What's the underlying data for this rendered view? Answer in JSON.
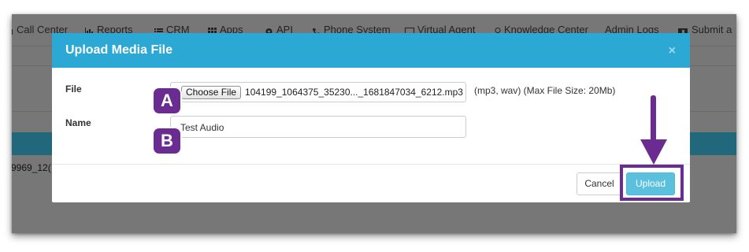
{
  "nav": {
    "items": [
      {
        "label": "Call Center",
        "icon": "phone-icon"
      },
      {
        "label": "Reports",
        "icon": "bar-chart-icon"
      },
      {
        "label": "CRM",
        "icon": "list-icon"
      },
      {
        "label": "Apps",
        "icon": "grid-icon"
      },
      {
        "label": "API",
        "icon": "gear-icon"
      },
      {
        "label": "Phone System",
        "icon": "phone-icon"
      },
      {
        "label": "Virtual Agent",
        "icon": "monitor-icon"
      },
      {
        "label": "Knowledge Center",
        "icon": "lightbulb-icon"
      },
      {
        "label": "Admin Logs",
        "icon": ""
      },
      {
        "label": "Submit a",
        "icon": "ticket-icon"
      }
    ]
  },
  "background": {
    "row_text": "9969_12("
  },
  "modal": {
    "title": "Upload Media File",
    "close_label": "×",
    "file_label": "File",
    "choose_file_label": "Choose File",
    "file_name": "104199_1064375_35230..._1681847034_6212.mp3",
    "file_hint": "(mp3, wav) (Max File Size: 20Mb)",
    "name_label": "Name",
    "name_value": "Test Audio",
    "cancel_label": "Cancel",
    "upload_label": "Upload"
  },
  "annotations": {
    "badge_a": "A",
    "badge_b": "B",
    "accent_color": "#6a2c91"
  },
  "colors": {
    "header": "#2ba8d3",
    "upload_button": "#5bc0de",
    "overlay": "#777777"
  }
}
